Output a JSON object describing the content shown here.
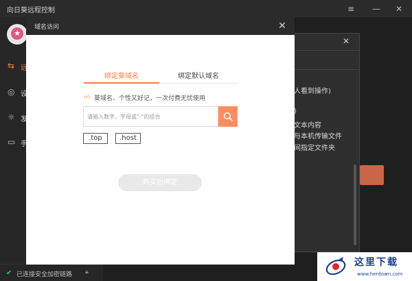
{
  "app": {
    "title": "向日葵远程控制",
    "window_controls": [
      "≡",
      "—",
      "✕"
    ]
  },
  "sidebar": {
    "items": [
      {
        "label": "远",
        "icon": "remote-control-icon",
        "active": true
      },
      {
        "label": "设",
        "icon": "device-icon",
        "active": false
      },
      {
        "label": "发",
        "icon": "discover-icon",
        "active": false
      },
      {
        "label": "手",
        "icon": "monitor-icon",
        "active": false
      }
    ],
    "status": "已连接安全加密链路"
  },
  "background_dialog": {
    "lines": [
      "人看到操作)",
      ")",
      "文本内容",
      "与本机传输文件",
      "间指定文件夹"
    ]
  },
  "modal": {
    "title": "域名访问",
    "tabs": [
      {
        "label": "绑定葵域名",
        "active": true
      },
      {
        "label": "绑定默认域名",
        "active": false
      }
    ],
    "promo_text": "葵域名、个性又好记，一次付费无忧使用",
    "search": {
      "value": "",
      "placeholder": "请输入数字、字母或\"-\"的组合"
    },
    "suffixes": [
      ".top",
      ".host"
    ],
    "buy_button": "购买后绑定"
  },
  "watermark": {
    "title": "这里下载",
    "url": "www.herdown.com"
  },
  "colors": {
    "accent": "#ff7c45",
    "search_button": "#ff8d62",
    "titlebar": "#2b2b2b",
    "secure_status": "#3cc77b"
  }
}
